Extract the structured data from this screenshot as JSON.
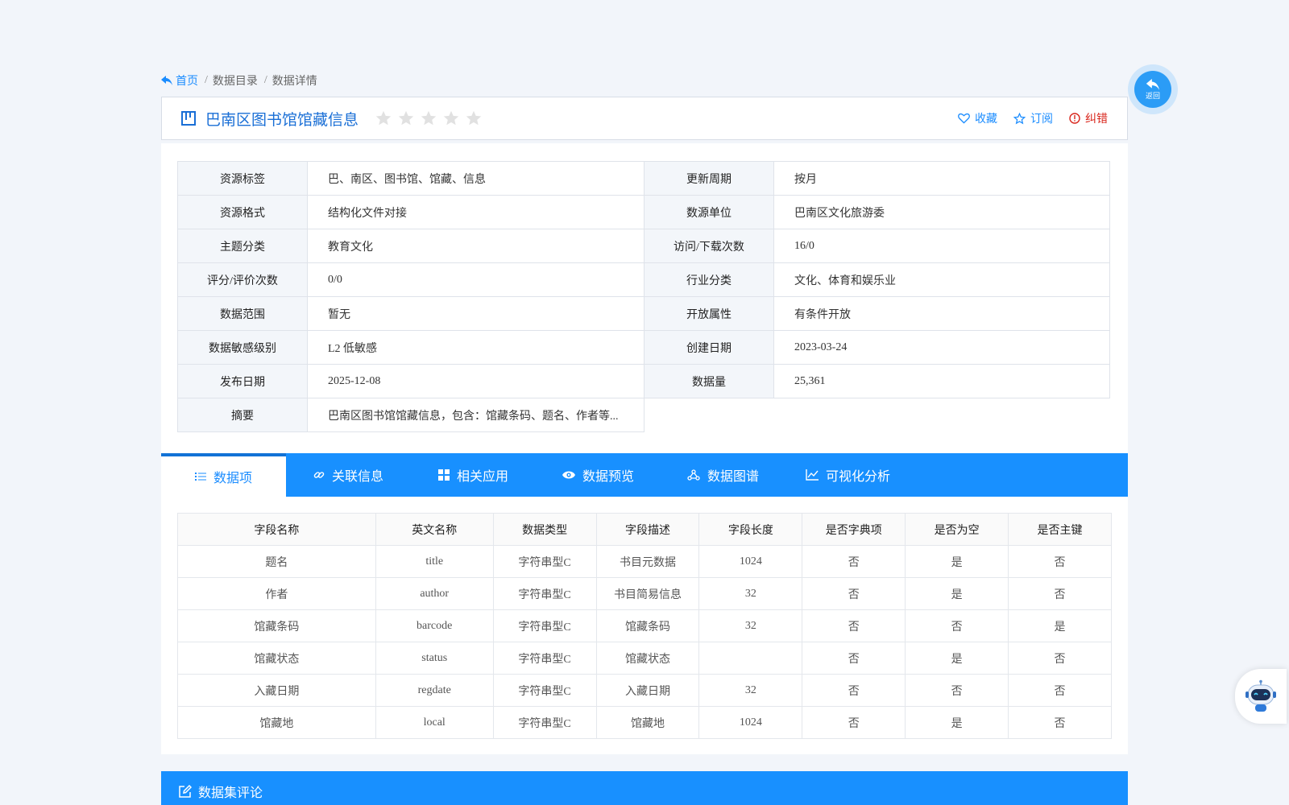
{
  "breadcrumb": {
    "home": "首页",
    "items": [
      "数据目录",
      "数据详情"
    ]
  },
  "title": "巴南区图书馆馆藏信息",
  "rating": {
    "stars_filled": 0,
    "stars_total": 5
  },
  "actions": {
    "favorite": "收藏",
    "subscribe": "订阅",
    "report": "纠错"
  },
  "back_label": "返回",
  "info_rows": [
    {
      "k1": "资源标签",
      "v1": "巴、南区、图书馆、馆藏、信息",
      "k2": "更新周期",
      "v2": "按月"
    },
    {
      "k1": "资源格式",
      "v1": "结构化文件对接",
      "k2": "数源单位",
      "v2": "巴南区文化旅游委"
    },
    {
      "k1": "主题分类",
      "v1": "教育文化",
      "k2": "访问/下载次数",
      "v2": "16/0"
    },
    {
      "k1": "评分/评价次数",
      "v1": "0/0",
      "k2": "行业分类",
      "v2": "文化、体育和娱乐业"
    },
    {
      "k1": "数据范围",
      "v1": "暂无",
      "k2": "开放属性",
      "v2": "有条件开放"
    },
    {
      "k1": "数据敏感级别",
      "v1": "L2 低敏感",
      "k2": "创建日期",
      "v2": "2023-03-24"
    },
    {
      "k1": "发布日期",
      "v1": "2025-12-08",
      "k2": "数据量",
      "v2": "25,361"
    },
    {
      "k1": "摘要",
      "v1": "巴南区图书馆馆藏信息，包含：馆藏条码、题名、作者等..."
    }
  ],
  "tabs": [
    "数据项",
    "关联信息",
    "相关应用",
    "数据预览",
    "数据图谱",
    "可视化分析"
  ],
  "fields_table": {
    "headers": [
      "字段名称",
      "英文名称",
      "数据类型",
      "字段描述",
      "字段长度",
      "是否字典项",
      "是否为空",
      "是否主键"
    ],
    "rows": [
      [
        "题名",
        "title",
        "字符串型C",
        "书目元数据",
        "1024",
        "否",
        "是",
        "否"
      ],
      [
        "作者",
        "author",
        "字符串型C",
        "书目简易信息",
        "32",
        "否",
        "是",
        "否"
      ],
      [
        "馆藏条码",
        "barcode",
        "字符串型C",
        "馆藏条码",
        "32",
        "否",
        "否",
        "是"
      ],
      [
        "馆藏状态",
        "status",
        "字符串型C",
        "馆藏状态",
        "",
        "否",
        "是",
        "否"
      ],
      [
        "入藏日期",
        "regdate",
        "字符串型C",
        "入藏日期",
        "32",
        "否",
        "否",
        "否"
      ],
      [
        "馆藏地",
        "local",
        "字符串型C",
        "馆藏地",
        "1024",
        "否",
        "是",
        "否"
      ]
    ]
  },
  "comment_title": "数据集评论",
  "colors": {
    "primary": "#1890ff",
    "title": "#1a6fd6",
    "danger": "#d9261c"
  }
}
